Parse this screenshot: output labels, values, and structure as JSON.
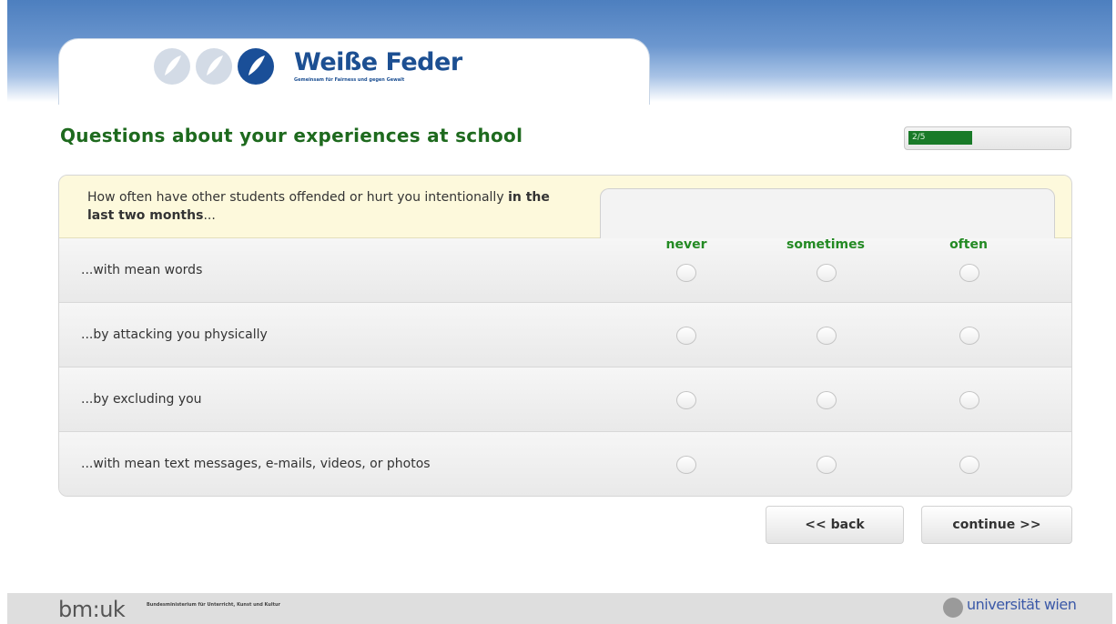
{
  "brand": {
    "name": "Weiße Feder",
    "tagline": "Gemeinsam für Fairness und gegen Gewalt"
  },
  "page": {
    "title": "Questions about your experiences at school",
    "progress_text": "2/5",
    "progress_fraction": 0.4
  },
  "question": {
    "text_before": "How often have other students offended or hurt you intentionally ",
    "text_bold": "in the last two months",
    "text_after": "..."
  },
  "columns": [
    "never",
    "sometimes",
    "often"
  ],
  "rows": [
    {
      "label": "...with mean words"
    },
    {
      "label": "...by attacking you physically"
    },
    {
      "label": "...by excluding you"
    },
    {
      "label": "...with mean text messages,  e-mails, videos, or photos"
    }
  ],
  "buttons": {
    "back": "<< back",
    "continue": "continue >>"
  },
  "footer": {
    "left_logo": "bm:uk",
    "left_sub": "Bundesministerium für Unterricht, Kunst und Kultur",
    "right_logo": "universität wien"
  },
  "colors": {
    "title_green": "#1e6a1e",
    "column_green": "#238a23",
    "progress_green": "#197a28",
    "brand_blue": "#1c4f92"
  }
}
